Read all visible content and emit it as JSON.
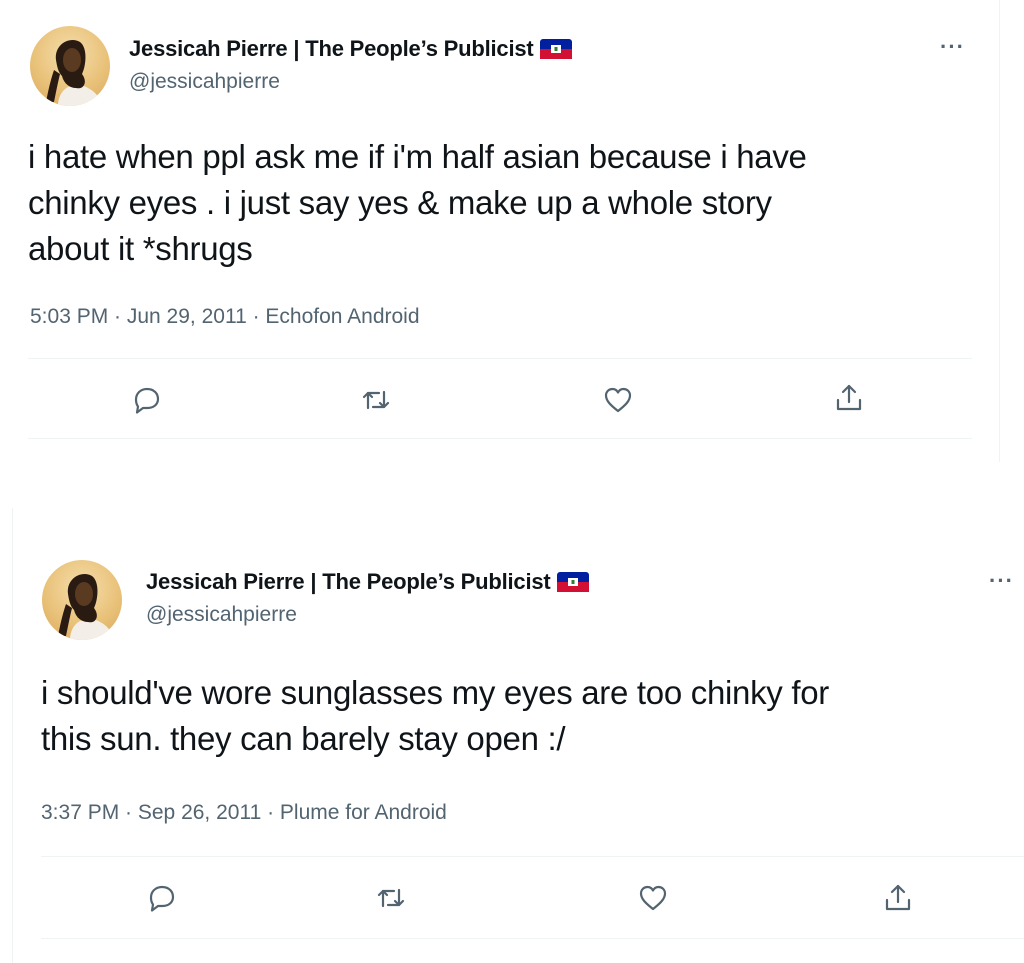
{
  "tweets": [
    {
      "display_name": "Jessicah Pierre | The People’s Publicist",
      "flag_icon": "haiti-flag-icon",
      "handle": "@jessicahpierre",
      "more_label": "···",
      "text": "i hate when ppl ask me if i'm half asian because i have\nchinky eyes . i just say yes & make up a whole story\nabout it *shrugs",
      "meta": "5:03 PM · Jun 29, 2011 · Echofon Android"
    },
    {
      "display_name": "Jessicah Pierre | The People’s Publicist",
      "flag_icon": "haiti-flag-icon",
      "handle": "@jessicahpierre",
      "more_label": "···",
      "text": "i should've wore sunglasses my eyes are too chinky for\nthis sun. they can barely stay open :/",
      "meta": "3:37 PM · Sep 26, 2011 · Plume for Android"
    }
  ],
  "actions": [
    "reply-icon",
    "retweet-icon",
    "like-icon",
    "share-icon"
  ],
  "colors": {
    "text_primary": "#0f1419",
    "text_secondary": "#536471",
    "divider": "#eff3f4",
    "flag_blue": "#00209f",
    "flag_red": "#d21034"
  }
}
